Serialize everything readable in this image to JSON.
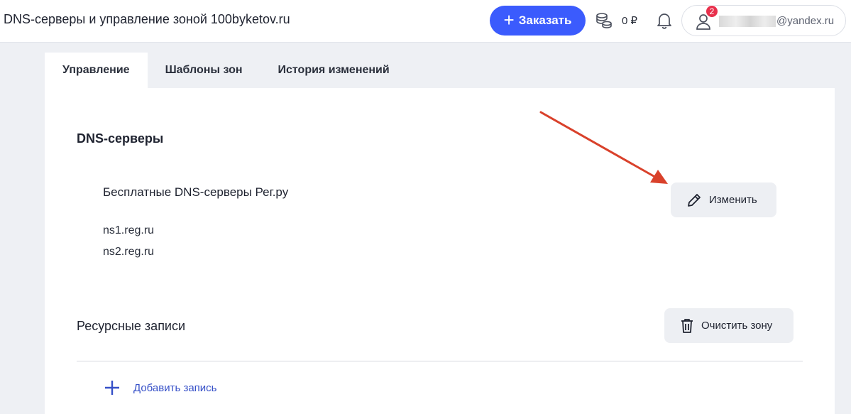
{
  "header": {
    "title": "DNS-серверы и управление зоной 100byketov.ru",
    "order_label": "Заказать",
    "balance": "0 ₽",
    "notifications_count": "2",
    "email_visible": "@yandex.ru"
  },
  "tabs": [
    {
      "label": "Управление",
      "active": true
    },
    {
      "label": "Шаблоны зон",
      "active": false
    },
    {
      "label": "История изменений",
      "active": false
    }
  ],
  "dns": {
    "title": "DNS-серверы",
    "provider": "Бесплатные DNS-серверы Рег.ру",
    "edit_label": "Изменить",
    "servers": [
      "ns1.reg.ru",
      "ns2.reg.ru"
    ]
  },
  "records": {
    "title": "Ресурсные записи",
    "clear_label": "Очистить зону",
    "add_label": "Добавить запись"
  },
  "colors": {
    "accent": "#3b5bfd",
    "badge": "#e8304c",
    "link": "#3650c8",
    "annotation_arrow": "#d9412b"
  }
}
